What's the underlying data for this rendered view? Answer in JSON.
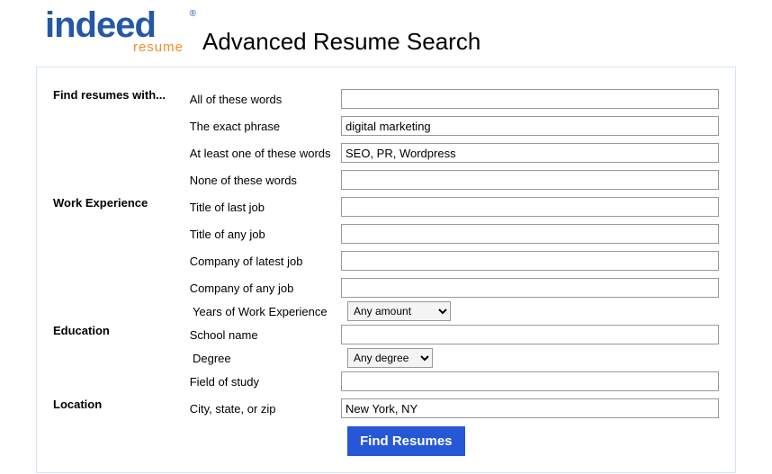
{
  "logo": {
    "main": "indeed",
    "sub": "resume",
    "reg": "®"
  },
  "page_title": "Advanced Resume Search",
  "sections": {
    "find": "Find resumes with...",
    "work": "Work Experience",
    "education": "Education",
    "location": "Location"
  },
  "labels": {
    "all_words": "All of these words",
    "exact": "The exact phrase",
    "at_least": "At least one of these words",
    "none": "None of these words",
    "title_last": "Title of last job",
    "title_any": "Title of any job",
    "company_latest": "Company of latest job",
    "company_any": "Company of any job",
    "years": "Years of Work Experience",
    "school": "School name",
    "degree": "Degree",
    "field": "Field of study",
    "city": "City, state, or zip"
  },
  "values": {
    "all_words": "",
    "exact": "digital marketing",
    "at_least": "SEO, PR, Wordpress",
    "none": "",
    "title_last": "",
    "title_any": "",
    "company_latest": "",
    "company_any": "",
    "school": "",
    "field": "",
    "city": "New York, NY"
  },
  "selects": {
    "years": "Any amount",
    "degree": "Any degree"
  },
  "submit": "Find Resumes"
}
